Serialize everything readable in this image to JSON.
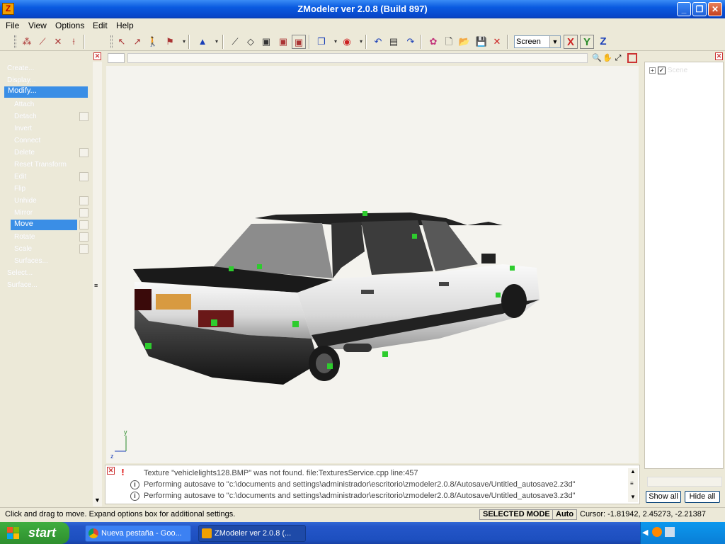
{
  "window": {
    "title": "ZModeler ver 2.0.8 (Build 897)",
    "icon": "zmodeler-app-icon",
    "minimize": "_",
    "maximize": "❐",
    "close": "✕"
  },
  "menu": {
    "items": [
      "File",
      "View",
      "Options",
      "Edit",
      "Help"
    ]
  },
  "toolbar": {
    "view_mode": "Screen",
    "axis_x": "X",
    "axis_y": "Y",
    "axis_z": "Z"
  },
  "left_panel": {
    "items": [
      {
        "label": "Create...",
        "selected": false
      },
      {
        "label": "Display...",
        "selected": false
      },
      {
        "label": "Modify...",
        "selected": true
      },
      {
        "label": "Attach",
        "selected": false
      },
      {
        "label": "Detach",
        "selected": false
      },
      {
        "label": "Invert",
        "selected": false
      },
      {
        "label": "Connect",
        "selected": false
      },
      {
        "label": "Delete",
        "selected": false
      },
      {
        "label": "Reset Transform",
        "selected": false
      },
      {
        "label": "Edit",
        "selected": false
      },
      {
        "label": "Flip",
        "selected": false
      },
      {
        "label": "Unhide",
        "selected": false
      },
      {
        "label": "Mirror",
        "selected": false
      },
      {
        "label": "Move",
        "selected": true
      },
      {
        "label": "Rotate",
        "selected": false
      },
      {
        "label": "Scale",
        "selected": false
      },
      {
        "label": "Surfaces...",
        "selected": false
      },
      {
        "label": "Select...",
        "selected": false
      },
      {
        "label": "Surface...",
        "selected": false
      }
    ]
  },
  "viewport": {
    "axis_y_label": "y",
    "axis_z_label": "z"
  },
  "log": {
    "lines": [
      {
        "type": "warning",
        "icon": "!",
        "text": "Texture \"vehiclelights128.BMP\" was not found. file:TexturesService.cpp line:457"
      },
      {
        "type": "info",
        "icon": "i",
        "text": "Performing autosave to \"c:\\documents and settings\\administrador\\escritorio\\zmodeler2.0.8/Autosave/Untitled_autosave2.z3d\""
      },
      {
        "type": "info",
        "icon": "i",
        "text": "Performing autosave to \"c:\\documents and settings\\administrador\\escritorio\\zmodeler2.0.8/Autosave/Untitled_autosave3.z3d\""
      }
    ]
  },
  "right_panel": {
    "tree_root": "Scene",
    "check": "✓",
    "plus": "+",
    "show_all": "Show all",
    "hide_all": "Hide all"
  },
  "status": {
    "message": "Click and drag to move. Expand options box for additional settings.",
    "mode": "SELECTED MODE",
    "auto": "Auto",
    "cursor": "Cursor: -1.81942, 2.45273, -2.21387"
  },
  "taskbar": {
    "start": "start",
    "tasks": [
      {
        "label": "Nueva pestaña - Goo...",
        "active": false
      },
      {
        "label": "ZModeler ver 2.0.8 (...",
        "active": true
      }
    ]
  },
  "colors": {
    "title_blue": "#0a5ae0",
    "selection_blue": "#3a8ee6",
    "vertex_green": "#2ecc2e",
    "close_red": "#cc3333"
  }
}
